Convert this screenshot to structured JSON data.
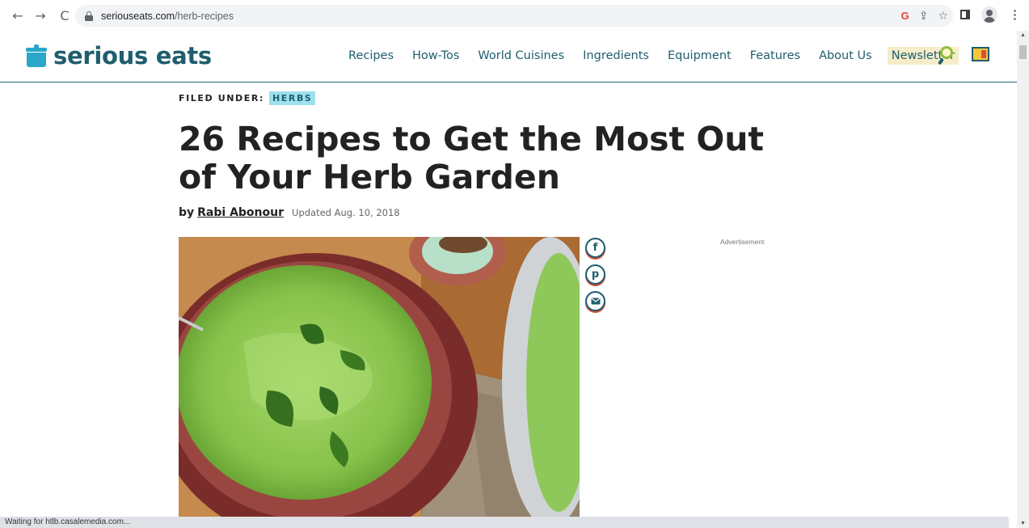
{
  "browser": {
    "url_domain": "seriouseats.com",
    "url_path": "/herb-recipes",
    "back_icon": "←",
    "forward_icon": "→",
    "reload_icon": "C",
    "google_icon": "G",
    "share_icon": "⇪",
    "star_icon": "☆",
    "menu_icon": "⋮"
  },
  "site": {
    "logo_text": "serious eats",
    "nav": [
      "Recipes",
      "How-Tos",
      "World Cuisines",
      "Ingredients",
      "Equipment",
      "Features",
      "About Us"
    ],
    "newsletter": "Newsletter"
  },
  "article": {
    "filed_label": "FILED UNDER:",
    "filed_tag": "HERBS",
    "title": "26 Recipes to Get the Most Out of Your Herb Garden",
    "by": "by",
    "author": "Rabi Abonour",
    "updated": "Updated Aug. 10, 2018",
    "share": {
      "facebook": "f",
      "pinterest": "p"
    }
  },
  "sidebar": {
    "ad_label": "Advertisement"
  },
  "status_bar": {
    "text": "Waiting for htlb.casalemedia.com..."
  },
  "colors": {
    "brand_teal": "#1f5e6e",
    "brand_blue": "#2aa7c9",
    "tag_bg": "#9ee0ec",
    "newsletter_bg": "#f5ecc9"
  }
}
